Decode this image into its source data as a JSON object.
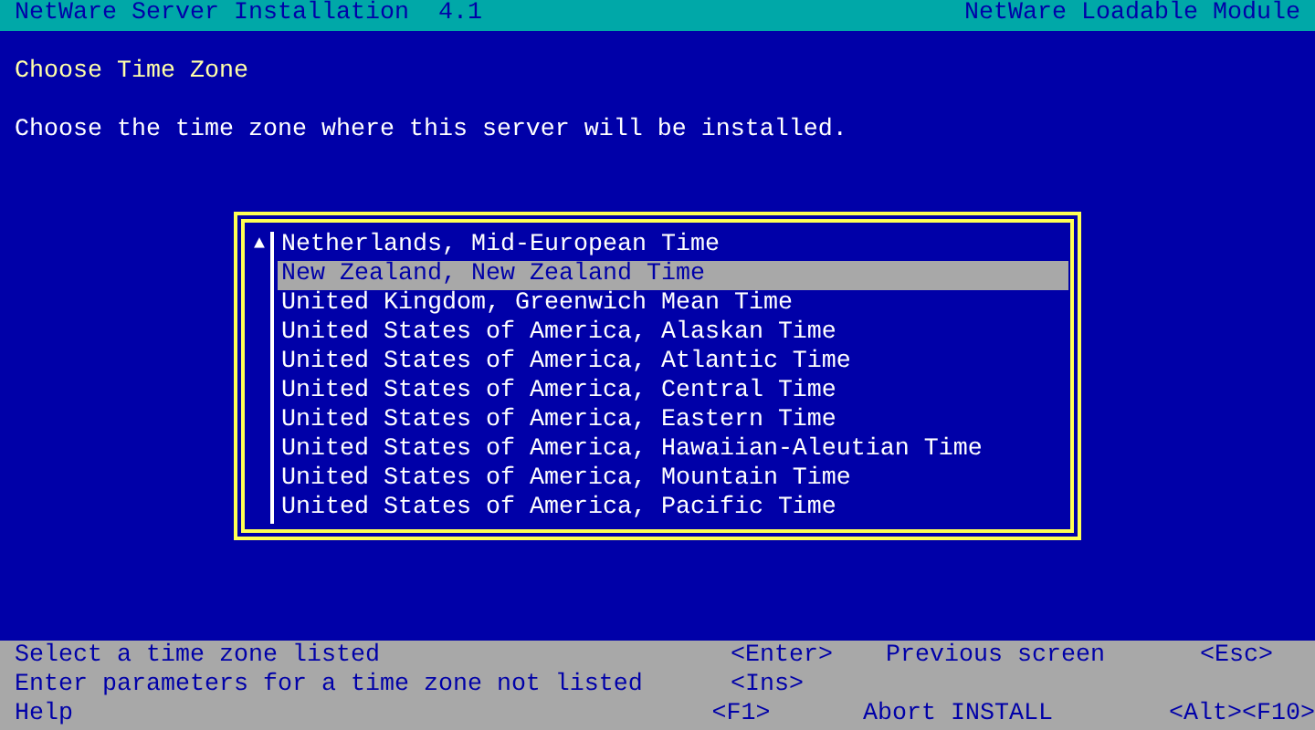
{
  "header": {
    "title": "NetWare Server Installation  4.1",
    "module": "NetWare Loadable Module"
  },
  "heading": "Choose Time Zone",
  "instruction": "Choose the time zone where this server will be installed.",
  "list": {
    "scroll_indicator": "▲",
    "items": [
      {
        "label": "Netherlands, Mid-European Time",
        "selected": false
      },
      {
        "label": "New Zealand, New Zealand Time",
        "selected": true
      },
      {
        "label": "United Kingdom, Greenwich Mean Time",
        "selected": false
      },
      {
        "label": "United States of America, Alaskan Time",
        "selected": false
      },
      {
        "label": "United States of America, Atlantic Time",
        "selected": false
      },
      {
        "label": "United States of America, Central Time",
        "selected": false
      },
      {
        "label": "United States of America, Eastern Time",
        "selected": false
      },
      {
        "label": "United States of America, Hawaiian-Aleutian Time",
        "selected": false
      },
      {
        "label": "United States of America, Mountain Time",
        "selected": false
      },
      {
        "label": "United States of America, Pacific Time",
        "selected": false
      }
    ]
  },
  "footer": [
    {
      "action": "Select a time zone listed",
      "key": "<Enter>",
      "action2": "Previous screen",
      "key2": "<Esc>"
    },
    {
      "action": "Enter parameters for a time zone not listed",
      "key": "<Ins>"
    },
    {
      "action": "Help",
      "key": "<F1>",
      "action2": "Abort INSTALL",
      "key2": "<Alt><F10>"
    }
  ]
}
